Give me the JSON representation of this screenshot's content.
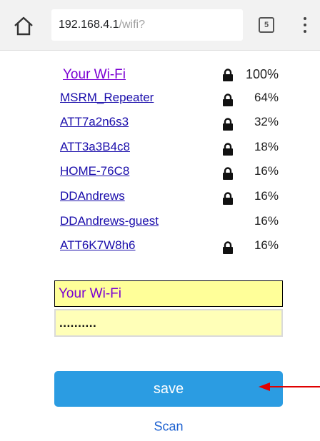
{
  "browser": {
    "url_host": "192.168.4.1",
    "url_path": "/wifi?",
    "tab_count": "5",
    "icons": {
      "home": "home-icon",
      "tabs": "tabs-icon",
      "menu": "more-vert-icon"
    }
  },
  "networks": [
    {
      "ssid": "Your Wi-Fi",
      "signal": "100%",
      "locked": true,
      "current": true
    },
    {
      "ssid": "MSRM_Repeater",
      "signal": "64%",
      "locked": true
    },
    {
      "ssid": "ATT7a2n6s3",
      "signal": "32%",
      "locked": true
    },
    {
      "ssid": "ATT3a3B4c8",
      "signal": "18%",
      "locked": true
    },
    {
      "ssid": "HOME-76C8",
      "signal": "16%",
      "locked": true
    },
    {
      "ssid": "DDAndrews",
      "signal": "16%",
      "locked": true
    },
    {
      "ssid": "DDAndrews-guest",
      "signal": "16%",
      "locked": false
    },
    {
      "ssid": "ATT6K7W8h6",
      "signal": "16%",
      "locked": true
    }
  ],
  "form": {
    "ssid_value": "Your Wi-Fi",
    "password_value": "..........",
    "save_label": "save",
    "scan_label": "Scan"
  },
  "annotation": {
    "arrow_color": "#e00000"
  },
  "colors": {
    "current_network": "#7b00d3",
    "link": "#1a0dab",
    "input_bg": "#ffff99",
    "button_bg": "#2b9ce2"
  }
}
